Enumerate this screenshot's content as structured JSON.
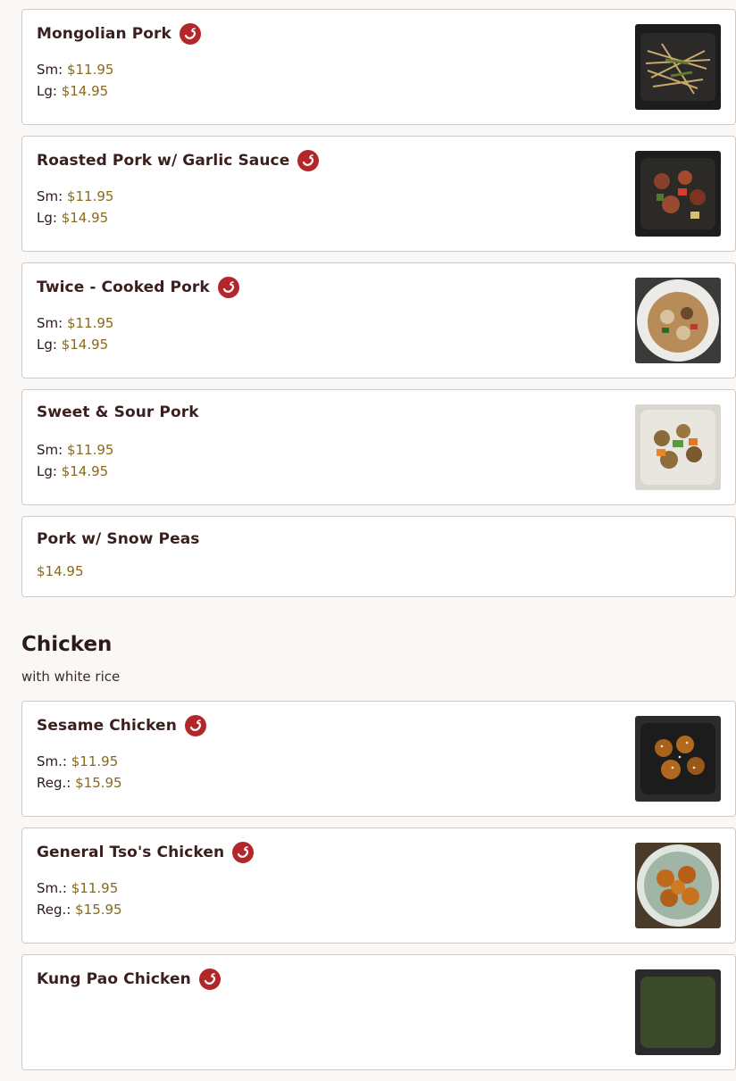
{
  "pork_items": [
    {
      "name": "Mongolian Pork",
      "spicy": true,
      "prices": [
        {
          "label": "Sm:",
          "value": "$11.95"
        },
        {
          "label": "Lg:",
          "value": "$14.95"
        }
      ],
      "image": "mongolian-pork-photo"
    },
    {
      "name": "Roasted Pork w/ Garlic Sauce",
      "spicy": true,
      "prices": [
        {
          "label": "Sm:",
          "value": "$11.95"
        },
        {
          "label": "Lg:",
          "value": "$14.95"
        }
      ],
      "image": "roasted-pork-photo"
    },
    {
      "name": "Twice - Cooked Pork",
      "spicy": true,
      "prices": [
        {
          "label": "Sm:",
          "value": "$11.95"
        },
        {
          "label": "Lg:",
          "value": "$14.95"
        }
      ],
      "image": "twice-cooked-pork-photo"
    },
    {
      "name": "Sweet & Sour Pork",
      "spicy": false,
      "prices": [
        {
          "label": "Sm:",
          "value": "$11.95"
        },
        {
          "label": "Lg:",
          "value": "$14.95"
        }
      ],
      "image": "sweet-sour-pork-photo"
    },
    {
      "name": "Pork w/ Snow Peas",
      "spicy": false,
      "prices": [
        {
          "label": "",
          "value": "$14.95"
        }
      ],
      "image": null
    }
  ],
  "chicken_section": {
    "title": "Chicken",
    "subtitle": "with white rice"
  },
  "chicken_items": [
    {
      "name": "Sesame Chicken",
      "spicy": true,
      "prices": [
        {
          "label": "Sm.:",
          "value": "$11.95"
        },
        {
          "label": "Reg.:",
          "value": "$15.95"
        }
      ],
      "image": "sesame-chicken-photo"
    },
    {
      "name": "General Tso's Chicken",
      "spicy": true,
      "prices": [
        {
          "label": "Sm.:",
          "value": "$11.95"
        },
        {
          "label": "Reg.:",
          "value": "$15.95"
        }
      ],
      "image": "general-tso-chicken-photo"
    },
    {
      "name": "Kung Pao Chicken",
      "spicy": true,
      "prices": [],
      "image": "kung-pao-chicken-photo"
    }
  ],
  "colors": {
    "accent_price": "#8a6a1a",
    "spicy_badge": "#b3272b",
    "border": "#cfcac6"
  },
  "icons": {
    "spicy": "chili-pepper-icon"
  }
}
